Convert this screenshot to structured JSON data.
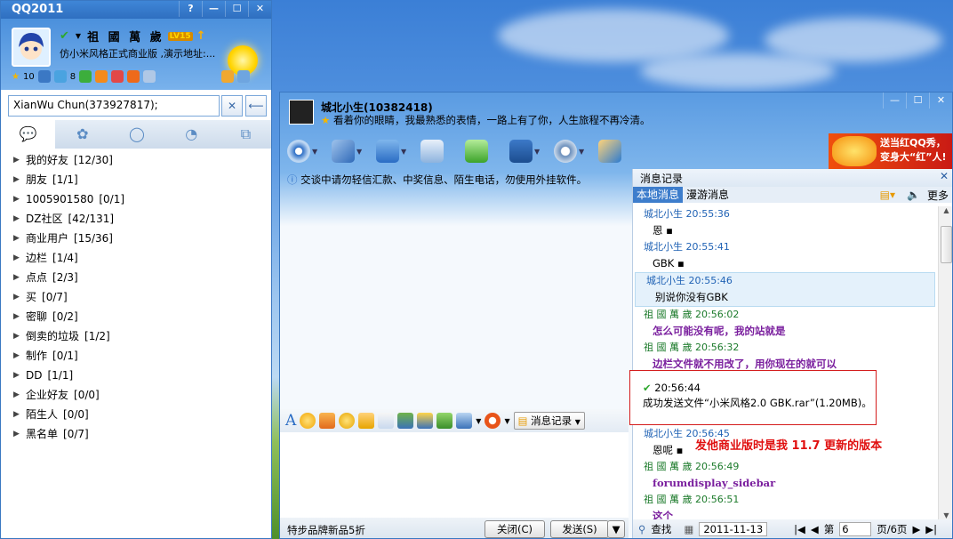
{
  "main": {
    "title": "QQ2011",
    "nick": "祖 國 萬 歲",
    "level": "LV15",
    "signature": "仿小米风格正式商业版 ,演示地址:...",
    "counts": {
      "a": "10",
      "b": "8"
    },
    "search_value": "XianWu Chun(373927817);",
    "groups": [
      {
        "name": "我的好友",
        "count": "[12/30]"
      },
      {
        "name": "朋友",
        "count": "[1/1]"
      },
      {
        "name": "1005901580",
        "count": "[0/1]"
      },
      {
        "name": "DZ社区",
        "count": "[42/131]"
      },
      {
        "name": "商业用户",
        "count": "[15/36]"
      },
      {
        "name": "边栏",
        "count": "[1/4]"
      },
      {
        "name": "点点",
        "count": "[2/3]"
      },
      {
        "name": "买",
        "count": "[0/7]"
      },
      {
        "name": "密聊",
        "count": "[0/2]"
      },
      {
        "name": "倒卖的垃圾",
        "count": "[1/2]"
      },
      {
        "name": "制作",
        "count": "[0/1]"
      },
      {
        "name": "DD",
        "count": "[1/1]"
      },
      {
        "name": "企业好友",
        "count": "[0/0]"
      },
      {
        "name": "陌生人",
        "count": "[0/0]"
      },
      {
        "name": "黑名单",
        "count": "[0/7]"
      }
    ]
  },
  "chat": {
    "contact": "城北小生(10382418)",
    "contact_sign": "看着你的眼睛，我最熟悉的表情，一路上有了你，人生旅程不再冷清。",
    "ad_text_1": "送当红QQ秀，",
    "ad_text_2": "变身大“红”人!",
    "warning": "交谈中请勿轻信汇款、中奖信息、陌生电话，勿使用外挂软件。",
    "history_btn": "消息记录",
    "bottom_ad": "特步品牌新品5折",
    "close_btn": "关闭(C)",
    "send_btn": "发送(S)"
  },
  "history": {
    "title": "消息记录",
    "tab_local": "本地消息",
    "tab_roam": "漫游消息",
    "more": "更多",
    "messages": [
      {
        "sender": "城北小生",
        "time": "20:55:36",
        "text": "恩 ▪"
      },
      {
        "sender": "城北小生",
        "time": "20:55:41",
        "text": "GBK ▪"
      },
      {
        "sender": "城北小生",
        "time": "20:55:46",
        "text": "别说你没有GBK"
      },
      {
        "sender": "祖 國 萬 歲",
        "time": "20:56:02",
        "text": "怎么可能没有呢，我的站就是"
      },
      {
        "sender": "祖 國 萬 歲",
        "time": "20:56:32",
        "text": "边栏文件就不用改了，用你现在的就可以"
      },
      {
        "sender": "城北小生",
        "time": "20:56:45",
        "text": "恩呢 ▪"
      },
      {
        "sender": "祖 國 萬 歲",
        "time": "20:56:49",
        "text": "forumdisplay_sidebar"
      },
      {
        "sender": "祖 國 萬 歲",
        "time": "20:56:51",
        "text": "这个"
      }
    ],
    "file_time": "20:56:44",
    "file_text": "成功发送文件“小米风格2.0 GBK.rar”(1.20MB)。",
    "annotation": "发他商业版时是我 11.7 更新的版本",
    "search": "查找",
    "date": "2011-11-13",
    "page_label": "第",
    "page_value": "6",
    "page_total": "页/6页"
  }
}
